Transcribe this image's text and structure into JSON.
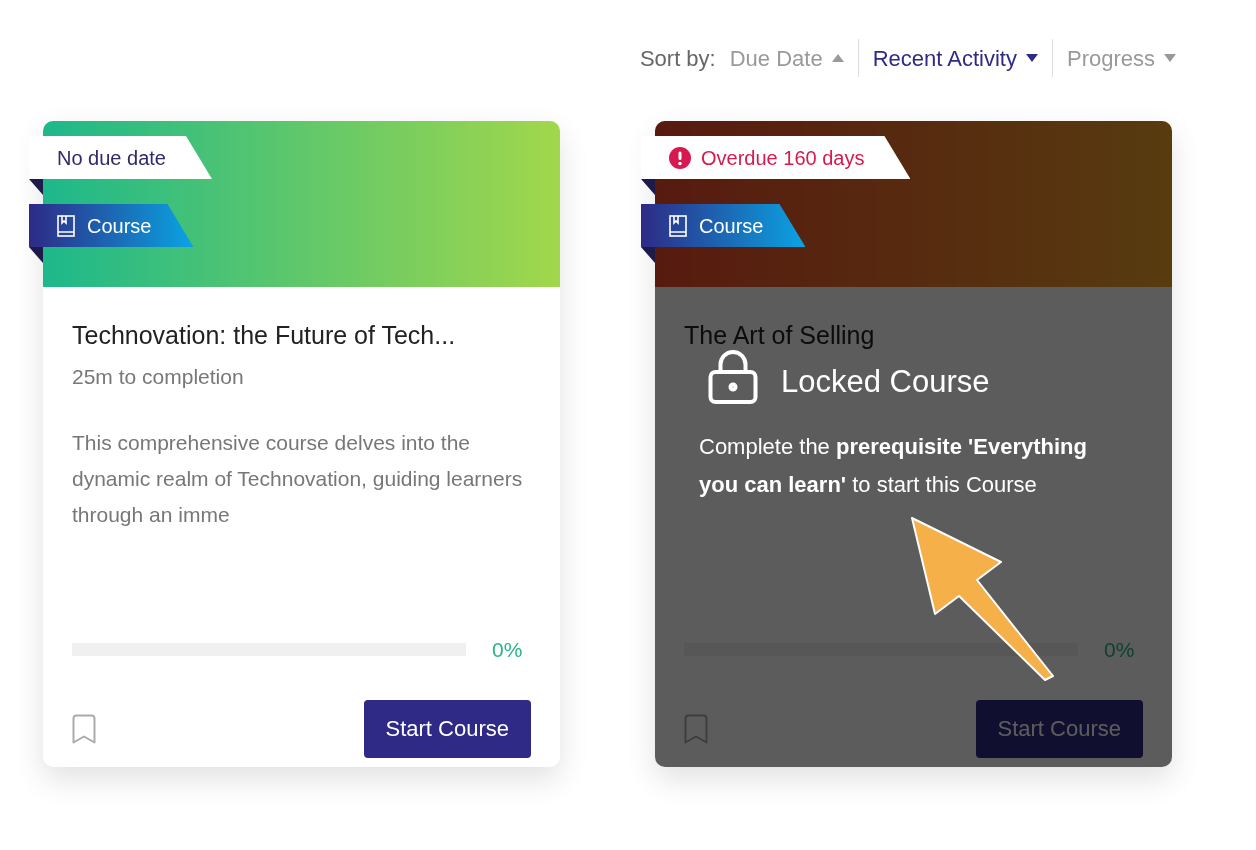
{
  "sort": {
    "label": "Sort by:",
    "options": [
      {
        "label": "Due Date",
        "kind": "ascending",
        "selected": false
      },
      {
        "label": "Recent Activity",
        "kind": "descending",
        "selected": true
      },
      {
        "label": "Progress",
        "kind": "descending",
        "selected": false
      }
    ]
  },
  "cards": [
    {
      "kind": "green",
      "due": {
        "kind": "none",
        "text": "No due date"
      },
      "type_label": "Course",
      "title": "Technovation: the Future of Tech...",
      "duration": "25m to completion",
      "description": "This comprehensive course delves into the dynamic realm of Technovation, guiding learners through an imme",
      "progress": {
        "reading": "0%"
      },
      "button": "Start Course",
      "locked": false
    },
    {
      "kind": "orange",
      "due": {
        "kind": "overdue",
        "text": "Overdue 160 days"
      },
      "type_label": "Course",
      "title": "The Art of Selling",
      "progress": {
        "reading": "0%"
      },
      "button": "Start Course",
      "locked": true,
      "lock_title": "Locked Course",
      "lock_message": "Complete the **prerequisite 'Everything you can learn'** to start this Course"
    }
  ],
  "annotation": {
    "kind": "arrow"
  }
}
